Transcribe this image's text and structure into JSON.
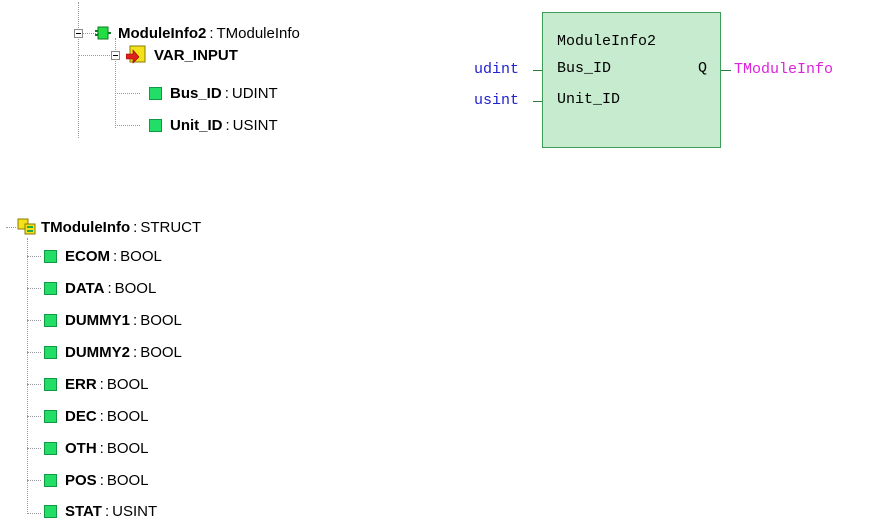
{
  "module": {
    "name": "ModuleInfo2",
    "type": "TModuleInfo",
    "group_label": "VAR_INPUT",
    "inputs": [
      {
        "name": "Bus_ID",
        "type": "UDINT"
      },
      {
        "name": "Unit_ID",
        "type": "USINT"
      }
    ]
  },
  "fblock": {
    "title": "ModuleInfo2",
    "pin_bus": "Bus_ID",
    "pin_unit": "Unit_ID",
    "output_pin": "Q",
    "input_type_bus": "udint",
    "input_type_unit": "usint",
    "output_type": "TModuleInfo",
    "colors": {
      "input_type": "#2222cc",
      "output_type": "#dd22dd",
      "block_fill": "#c6ebcf",
      "block_border": "#3b9d57"
    }
  },
  "struct": {
    "name": "TModuleInfo",
    "type": "STRUCT",
    "fields": [
      {
        "name": "ECOM",
        "type": "BOOL"
      },
      {
        "name": "DATA",
        "type": "BOOL"
      },
      {
        "name": "DUMMY1",
        "type": "BOOL"
      },
      {
        "name": "DUMMY2",
        "type": "BOOL"
      },
      {
        "name": "ERR",
        "type": "BOOL"
      },
      {
        "name": "DEC",
        "type": "BOOL"
      },
      {
        "name": "OTH",
        "type": "BOOL"
      },
      {
        "name": "POS",
        "type": "BOOL"
      },
      {
        "name": "STAT",
        "type": "USINT"
      }
    ]
  },
  "icons": {
    "module": "function-block-icon",
    "var_input": "var-input-icon",
    "struct": "struct-icon",
    "field": "variable-icon"
  }
}
